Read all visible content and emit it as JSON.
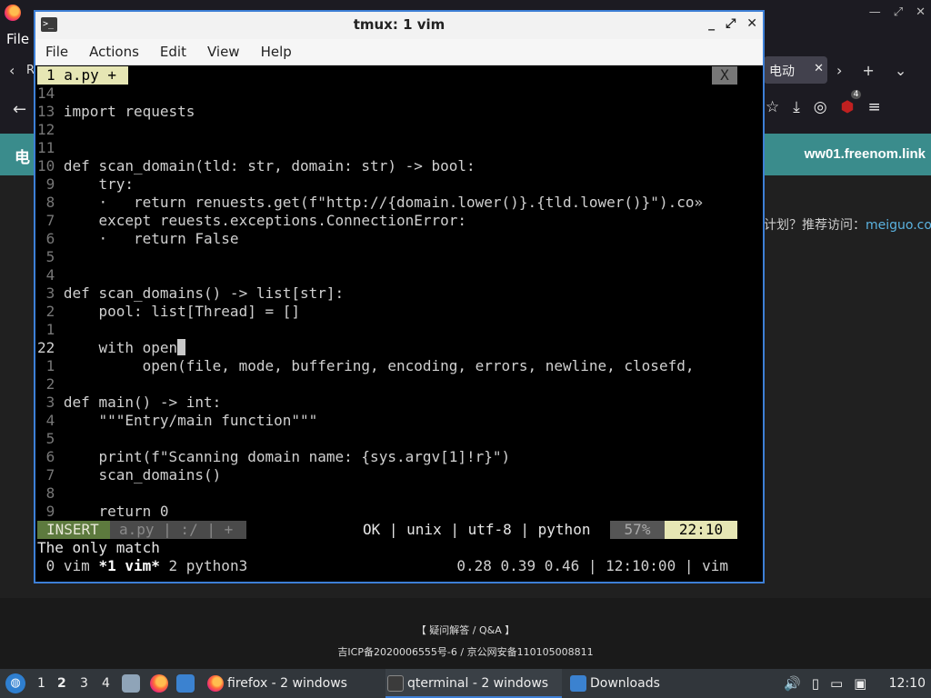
{
  "firefox": {
    "menu_file": "File",
    "tab_short": "R",
    "active_tab_label": "电动",
    "active_tab_close": "✕",
    "site_header_left": "电",
    "site_header_right": "ww01.freenom.link",
    "promo_text": "计划？推荐访问：",
    "promo_link": "meiguo.com",
    "footer_line1": "【 疑问解答 / Q&A 】",
    "footer_line2": "吉ICP备2020006555号-6 / 京公网安备110105008811",
    "notif_badge": "4",
    "icons": [
      "back-arrow-icon",
      "bookmark-star-icon",
      "download-icon",
      "incognito-icon",
      "ublock-icon",
      "menu-icon"
    ]
  },
  "terminal": {
    "title": "tmux: 1 vim",
    "window_controls": [
      "_",
      "⤢",
      "✕"
    ],
    "menu": [
      "File",
      "Actions",
      "Edit",
      "View",
      "Help"
    ]
  },
  "vim": {
    "tab_label": "1 a.py +",
    "tab_close": "X",
    "lines": [
      {
        "num": "14",
        "code": ""
      },
      {
        "num": "13",
        "code": "import requests"
      },
      {
        "num": "12",
        "code": ""
      },
      {
        "num": "11",
        "code": ""
      },
      {
        "num": "10",
        "code": "def scan_domain(tld: str, domain: str) -> bool:"
      },
      {
        "num": " 9",
        "code": "    try:"
      },
      {
        "num": " 8",
        "code": "    ·   return renuests.get(f\"http://{domain.lower()}.{tld.lower()}\").co»"
      },
      {
        "num": " 7",
        "code": "    except reuests.exceptions.ConnectionError:"
      },
      {
        "num": " 6",
        "code": "    ·   return False"
      },
      {
        "num": " 5",
        "code": ""
      },
      {
        "num": " 4",
        "code": ""
      },
      {
        "num": " 3",
        "code": "def scan_domains() -> list[str]:"
      },
      {
        "num": " 2",
        "code": "    pool: list[Thread] = []"
      },
      {
        "num": " 1",
        "code": ""
      },
      {
        "num": "22",
        "code": "    with open"
      },
      {
        "num": " 1",
        "code": "         open(file, mode, buffering, encoding, errors, newline, closefd,"
      },
      {
        "num": " 2",
        "code": ""
      },
      {
        "num": " 3",
        "code": "def main() -> int:"
      },
      {
        "num": " 4",
        "code": "    \"\"\"Entry/main function\"\"\""
      },
      {
        "num": " 5",
        "code": ""
      },
      {
        "num": " 6",
        "code": "    print(f\"Scanning domain name: {sys.argv[1]!r}\")"
      },
      {
        "num": " 7",
        "code": "    scan_domains()"
      },
      {
        "num": " 8",
        "code": ""
      },
      {
        "num": " 9",
        "code": "    return 0"
      }
    ],
    "status_mode": "INSERT",
    "status_file": "a.py | :/ | +",
    "status_right": "OK | unix | utf-8 | python",
    "status_percent": "57%",
    "status_position": "22:10",
    "message": "The only match"
  },
  "tmux": {
    "windows_left": " 0 vim ",
    "window_active": "*1 vim*",
    "windows_rest": " 2 python3",
    "right": "0.28 0.39 0.46 | 12:10:00 | vim"
  },
  "taskbar": {
    "start_icon": "start-menu-icon",
    "desktops": [
      "1",
      "2",
      "3",
      "4"
    ],
    "tasks": [
      {
        "label": "firefox - 2 windows"
      },
      {
        "label": "qterminal - 2 windows"
      },
      {
        "label": "Downloads"
      }
    ],
    "clock": "12:10"
  }
}
